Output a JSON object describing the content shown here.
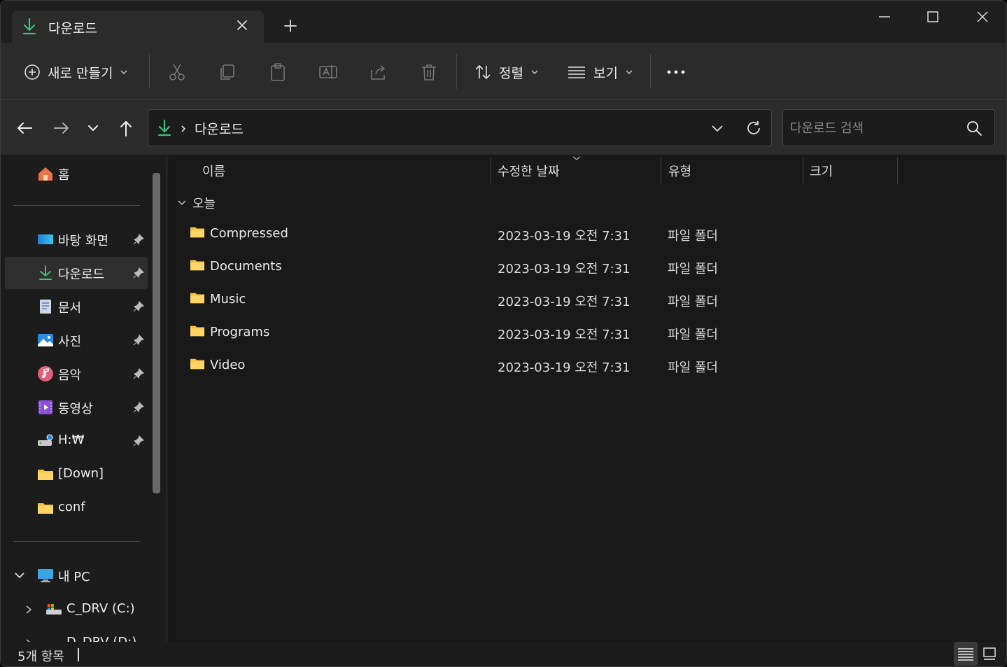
{
  "window": {
    "tab_title": "다운로드",
    "icon": "download-icon",
    "controls": [
      "minimize-icon",
      "maximize-icon",
      "close-icon"
    ]
  },
  "toolbar": {
    "new_label": "새로 만들기",
    "sort_label": "정렬",
    "view_label": "보기",
    "icons": [
      "cut-icon",
      "copy-icon",
      "paste-icon",
      "rename-icon",
      "share-icon",
      "delete-icon",
      "more-icon"
    ]
  },
  "address": {
    "path": "다운로드",
    "search_placeholder": "다운로드 검색"
  },
  "sidebar": {
    "home": "홈",
    "quick": [
      {
        "label": "바탕 화면",
        "icon": "desktop-icon",
        "pinned": true
      },
      {
        "label": "다운로드",
        "icon": "download-icon",
        "pinned": true,
        "active": true
      },
      {
        "label": "문서",
        "icon": "document-icon",
        "pinned": true
      },
      {
        "label": "사진",
        "icon": "pictures-icon",
        "pinned": true
      },
      {
        "label": "음악",
        "icon": "music-icon",
        "pinned": true
      },
      {
        "label": "동영상",
        "icon": "video-icon",
        "pinned": true
      },
      {
        "label": "H:₩",
        "icon": "network-drive-icon",
        "pinned": true
      },
      {
        "label": "[Down]",
        "icon": "folder-icon",
        "pinned": false
      },
      {
        "label": "conf",
        "icon": "folder-icon",
        "pinned": false
      }
    ],
    "this_pc": "내 PC",
    "drives": [
      {
        "label": "C_DRV (C:)",
        "icon": "drive-icon"
      },
      {
        "label": "D_DRV (D:)",
        "icon": "drive-icon"
      }
    ]
  },
  "columns": {
    "name": "이름",
    "date": "수정한 날짜",
    "type": "유형",
    "size": "크기"
  },
  "group_label": "오늘",
  "files": [
    {
      "name": "Compressed",
      "date": "2023-03-19 오전 7:31",
      "type": "파일 폴더"
    },
    {
      "name": "Documents",
      "date": "2023-03-19 오전 7:31",
      "type": "파일 폴더"
    },
    {
      "name": "Music",
      "date": "2023-03-19 오전 7:31",
      "type": "파일 폴더"
    },
    {
      "name": "Programs",
      "date": "2023-03-19 오전 7:31",
      "type": "파일 폴더"
    },
    {
      "name": "Video",
      "date": "2023-03-19 오전 7:31",
      "type": "파일 폴더"
    }
  ],
  "status": {
    "count_text": "5개 항목"
  },
  "colors": {
    "accent_download": "#3cc07a",
    "folder": "#f5c242"
  }
}
